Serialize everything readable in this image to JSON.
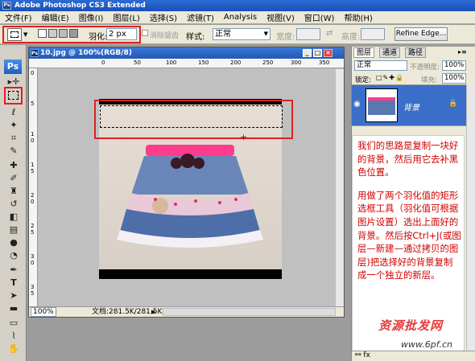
{
  "window": {
    "title": "Adobe Photoshop CS3 Extended"
  },
  "menu": [
    "文件(F)",
    "编辑(E)",
    "图像(I)",
    "图层(L)",
    "选择(S)",
    "滤镜(T)",
    "Analysis",
    "视图(V)",
    "窗口(W)",
    "帮助(H)"
  ],
  "options": {
    "feather_label": "羽化:",
    "feather_value": "2 px",
    "antialias_label": "消除锯齿",
    "style_label": "样式:",
    "style_value": "正常",
    "width_label": "宽度:",
    "height_label": "高度:",
    "refine_edge": "Refine Edge..."
  },
  "toolbox": {
    "ps_logo": "Ps"
  },
  "document": {
    "title": "10.jpg @ 100%(RGB/8)",
    "zoom": "100%",
    "doc_info": "文档:281.5K/281.5K"
  },
  "ruler_h": [
    "0",
    "50",
    "100",
    "150",
    "200",
    "250",
    "300",
    "350"
  ],
  "ruler_v": [
    "0",
    "5",
    "1 0",
    "1 5",
    "2 0",
    "2 5",
    "3 0",
    "3 5"
  ],
  "layers_panel": {
    "tabs": [
      "图层",
      "通道",
      "路径"
    ],
    "blend_mode": "正常",
    "opacity_label": "不透明度:",
    "opacity_value": "100%",
    "lock_label": "锁定:",
    "fill_label": "填充:",
    "fill_value": "100%",
    "layer_name": "背景"
  },
  "annotation": {
    "para1": "我们的思路是复制一块好的背景，然后用它去补黑色位置。",
    "para2": "用做了两个羽化值的矩形选框工具（羽化值可根据图片设置）选出上面好的背景。然后按Ctrl+J(或图层—新建—通过拷贝的图层)把选择好的背景复制成一个独立的新层。"
  },
  "watermark": {
    "cn": "资源批发网",
    "url": "www.6pf.cn"
  },
  "colors": {
    "title_blue": "#2358b8",
    "annotation_red": "#d00000",
    "highlight_red": "#e02020"
  }
}
